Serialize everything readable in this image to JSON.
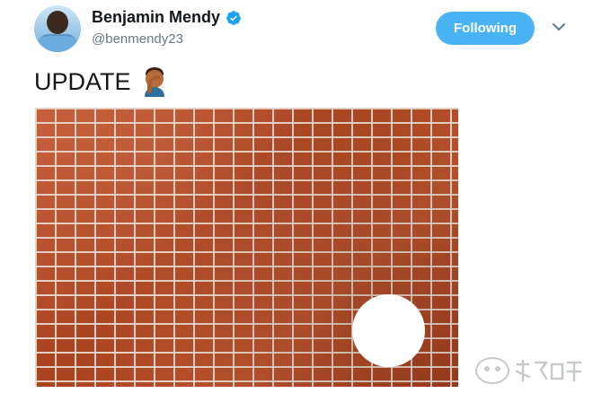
{
  "user": {
    "name": "Benjamin Mendy",
    "handle": "@benmendy23",
    "verified_icon": "verified-badge-icon",
    "avatar_icon": "profile-avatar"
  },
  "actions": {
    "follow_label": "Following",
    "follow_color": "#4ab3f4",
    "more_icon": "chevron-down-icon"
  },
  "tweet": {
    "text": "UPDATE",
    "emoji": "facepalm-emoji",
    "media_description_icon": "brick-wall-image"
  },
  "colors": {
    "text": "#14171a",
    "secondary": "#657786",
    "verified": "#1da1f2"
  }
}
